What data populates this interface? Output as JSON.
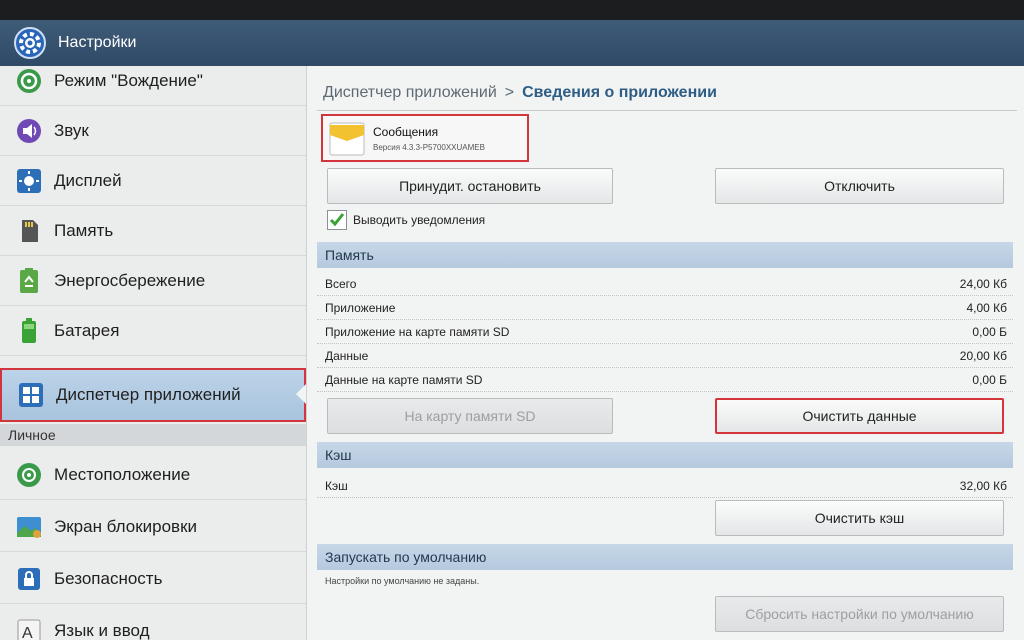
{
  "window": {
    "title": "Настройки"
  },
  "sidebar": {
    "items": [
      {
        "label": "Режим \"Вождение\"",
        "icon": "steering-wheel-icon"
      },
      {
        "label": "Звук",
        "icon": "speaker-icon"
      },
      {
        "label": "Дисплей",
        "icon": "brightness-icon"
      },
      {
        "label": "Память",
        "icon": "sd-card-icon"
      },
      {
        "label": "Энергосбережение",
        "icon": "recycle-icon"
      },
      {
        "label": "Батарея",
        "icon": "battery-icon"
      },
      {
        "label": "Диспетчер приложений",
        "icon": "grid-icon",
        "active": true
      }
    ],
    "section_personal": "Личное",
    "personal_items": [
      {
        "label": "Местоположение",
        "icon": "location-icon"
      },
      {
        "label": "Экран блокировки",
        "icon": "lock-screen-icon"
      },
      {
        "label": "Безопасность",
        "icon": "padlock-icon"
      },
      {
        "label": "Язык и ввод",
        "icon": "language-icon"
      }
    ]
  },
  "breadcrumb": {
    "parent": "Диспетчер приложений",
    "separator": ">",
    "current": "Сведения о приложении"
  },
  "app": {
    "name": "Сообщения",
    "version": "Версия 4.3.3-P5700XXUAMEB"
  },
  "buttons": {
    "force_stop": "Принудит. остановить",
    "disable": "Отключить",
    "move_to_sd": "На карту памяти SD",
    "clear_data": "Очистить данные",
    "clear_cache": "Очистить кэш",
    "reset_defaults": "Сбросить настройки по умолчанию"
  },
  "notifications": {
    "label": "Выводить уведомления",
    "checked": true
  },
  "memory": {
    "title": "Память",
    "rows": [
      {
        "label": "Всего",
        "value": "24,00 Кб"
      },
      {
        "label": "Приложение",
        "value": "4,00 Кб"
      },
      {
        "label": "Приложение на карте памяти SD",
        "value": "0,00 Б"
      },
      {
        "label": "Данные",
        "value": "20,00 Кб"
      },
      {
        "label": "Данные на карте памяти SD",
        "value": "0,00 Б"
      }
    ]
  },
  "cache": {
    "title": "Кэш",
    "label": "Кэш",
    "value": "32,00 Кб"
  },
  "defaults": {
    "title": "Запускать по умолчанию",
    "note": "Настройки по умолчанию не заданы."
  },
  "colors": {
    "titlebar": "#34506d",
    "highlight": "#d2363c",
    "active_item": "#b3cbe3",
    "check": "#3aa335"
  }
}
